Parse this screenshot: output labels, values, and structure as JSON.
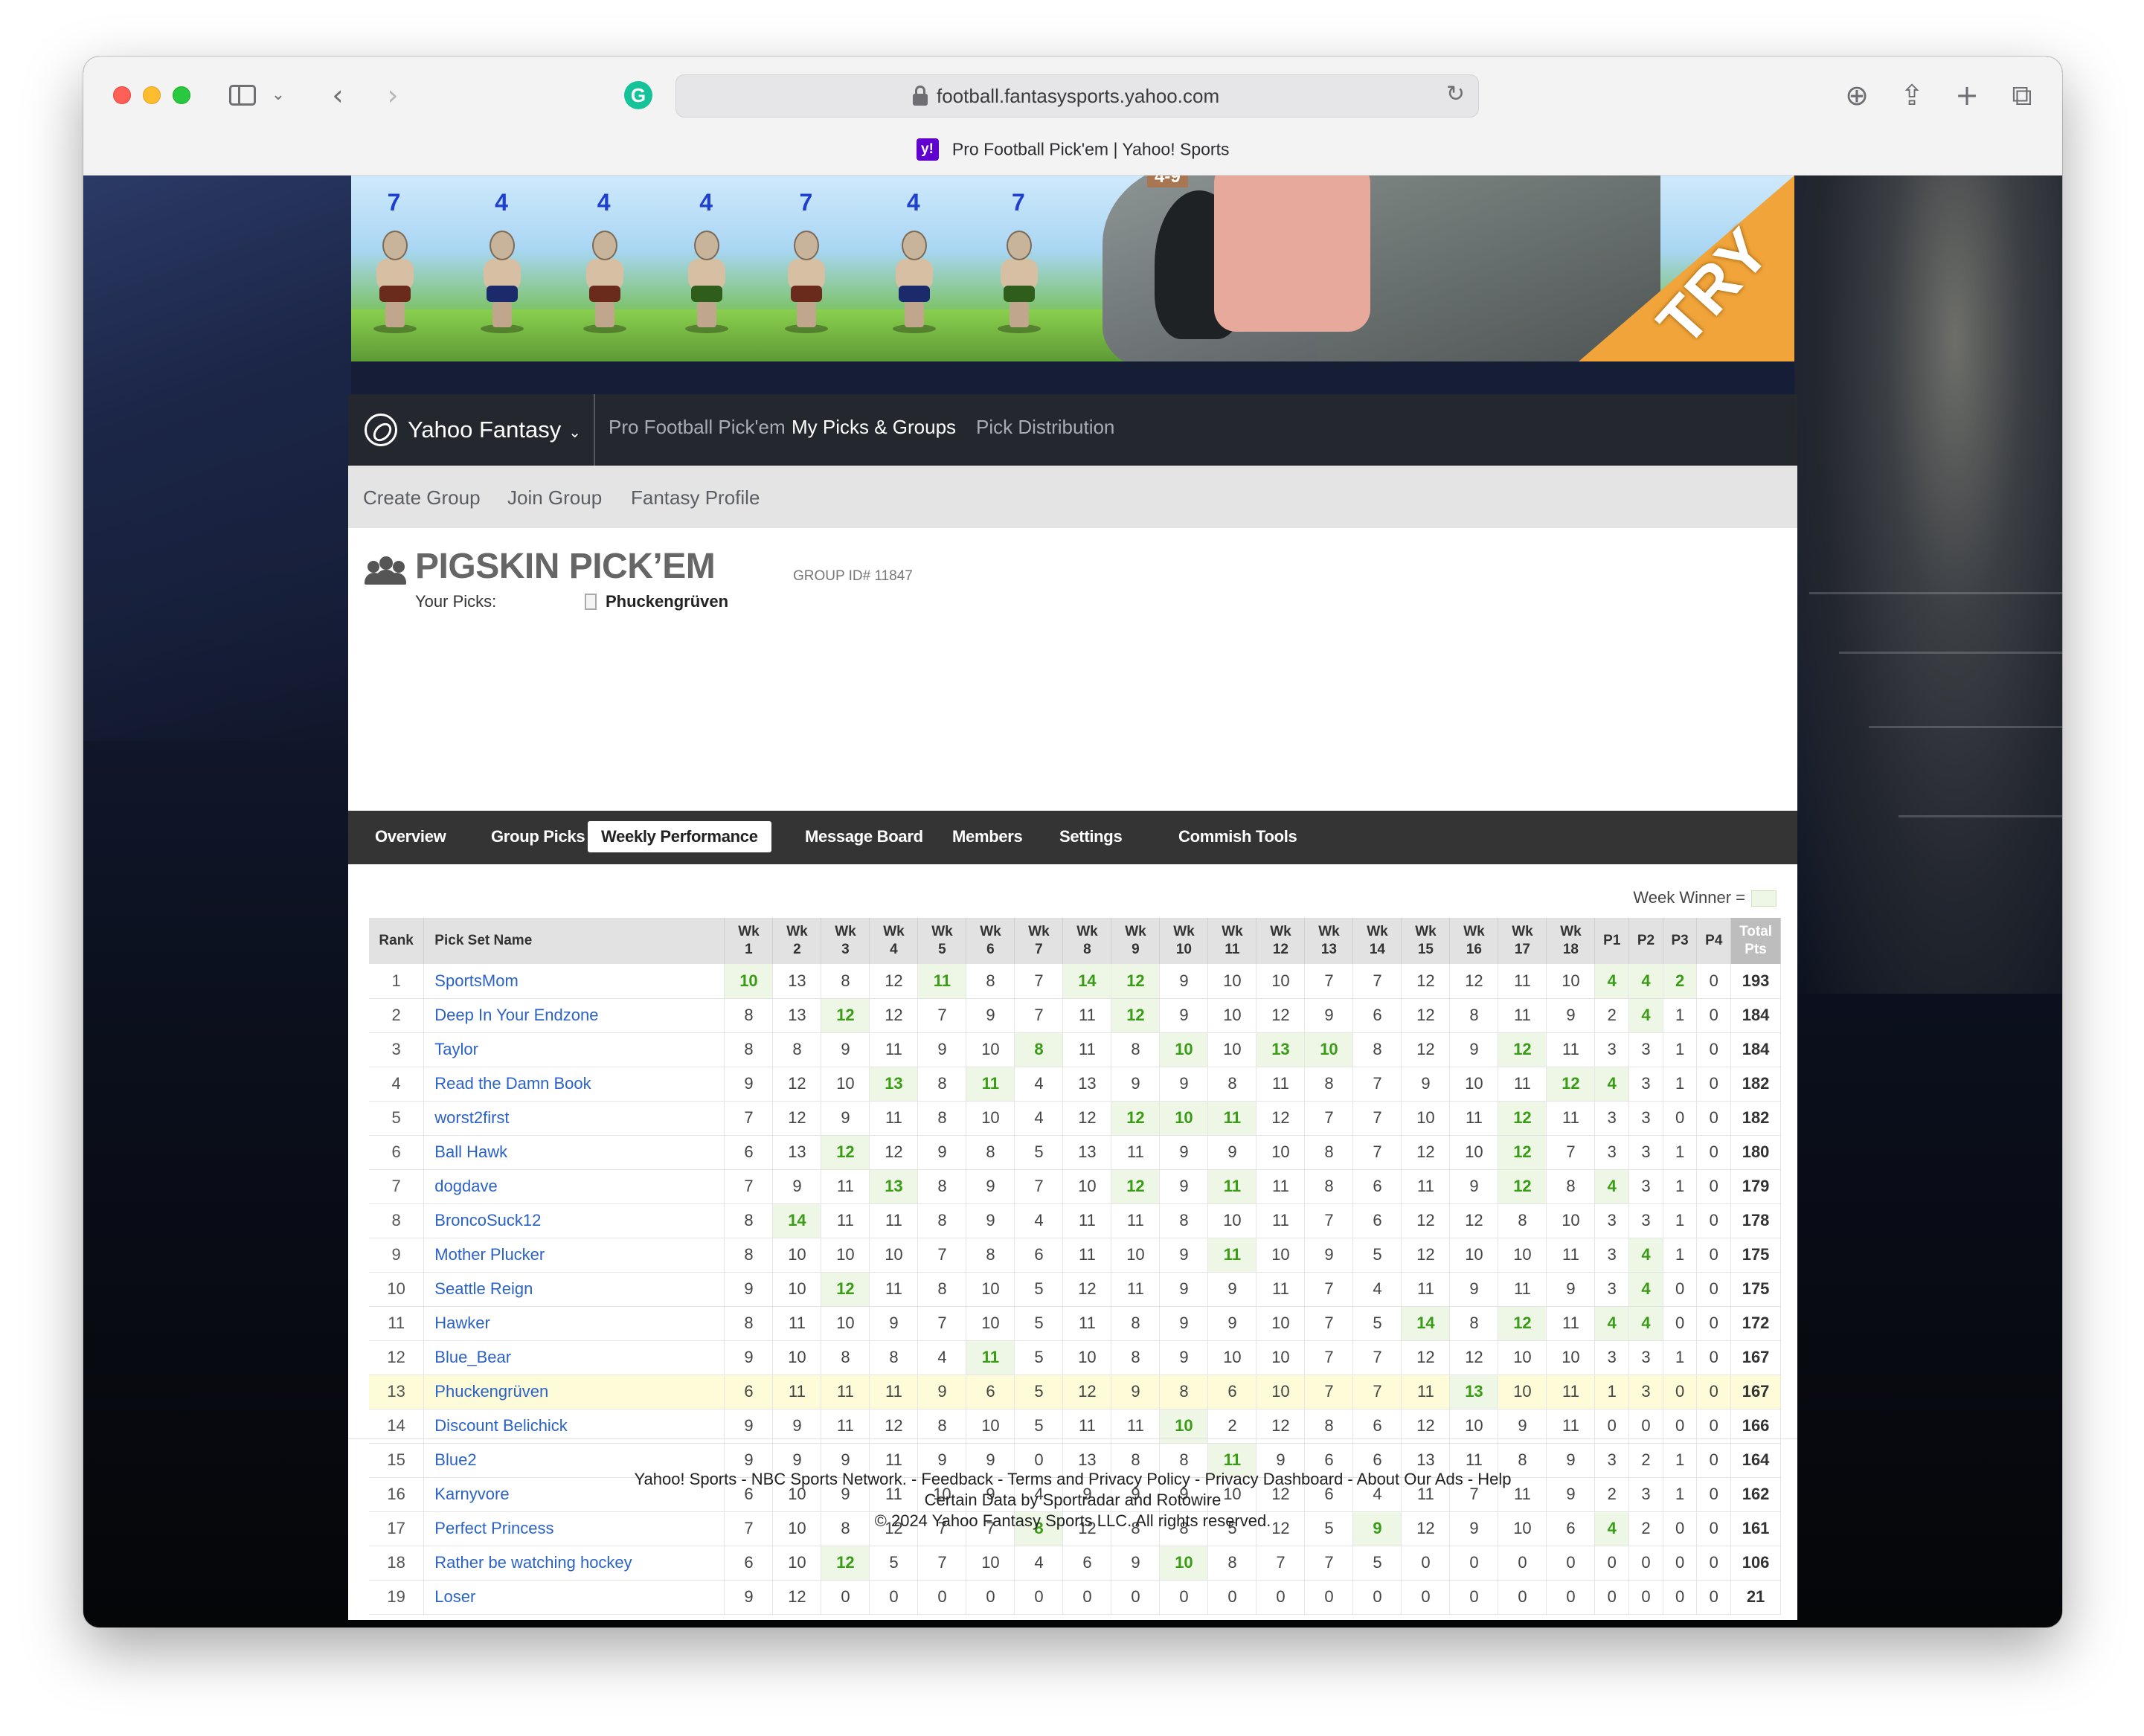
{
  "browser": {
    "address": "football.fantasysports.yahoo.com",
    "tab_title": "Pro Football Pick'em | Yahoo! Sports",
    "favicon_text": "y!"
  },
  "ad": {
    "numbers": [
      "7",
      "4",
      "4",
      "4",
      "7",
      "4",
      "7"
    ],
    "rock_label": "4-9",
    "cta": "TRY"
  },
  "nav": {
    "brand": "Yahoo Fantasy",
    "links": [
      "Pro Football Pick'em",
      "My Picks & Groups",
      "Pick Distribution"
    ],
    "active": "My Picks & Groups"
  },
  "subnav": [
    "Create Group",
    "Join Group",
    "Fantasy Profile"
  ],
  "group": {
    "title": "PIGSKIN PICK’EM",
    "id_label": "GROUP ID# 11847",
    "your_picks_label": "Your Picks:",
    "your_picks_name": "Phuckengrüven"
  },
  "tabs": [
    "Overview",
    "Group Picks",
    "Weekly Performance",
    "Message Board",
    "Members",
    "Settings",
    "Commish Tools"
  ],
  "active_tab": "Weekly Performance",
  "legend": "Week Winner =",
  "table": {
    "headers": {
      "rank": "Rank",
      "name": "Pick Set Name",
      "weeks": [
        "1",
        "2",
        "3",
        "4",
        "5",
        "6",
        "7",
        "8",
        "9",
        "10",
        "11",
        "12",
        "13",
        "14",
        "15",
        "16",
        "17",
        "18"
      ],
      "week_prefix": "Wk",
      "playoffs": [
        "P1",
        "P2",
        "P3",
        "P4"
      ],
      "total_top": "Total",
      "total_bottom": "Pts"
    },
    "rows": [
      {
        "rank": "1",
        "name": "SportsMom",
        "weeks": [
          "10",
          "13",
          "8",
          "12",
          "11",
          "8",
          "7",
          "14",
          "12",
          "9",
          "10",
          "10",
          "7",
          "7",
          "12",
          "12",
          "11",
          "10"
        ],
        "playoffs": [
          "4",
          "4",
          "2",
          "0"
        ],
        "total": "193",
        "wins": [
          0,
          4,
          7,
          8,
          18,
          19,
          20
        ]
      },
      {
        "rank": "2",
        "name": "Deep In Your Endzone",
        "weeks": [
          "8",
          "13",
          "12",
          "12",
          "7",
          "9",
          "7",
          "11",
          "12",
          "9",
          "10",
          "12",
          "9",
          "6",
          "12",
          "8",
          "11",
          "9"
        ],
        "playoffs": [
          "2",
          "4",
          "1",
          "0"
        ],
        "total": "184",
        "wins": [
          2,
          8,
          19
        ]
      },
      {
        "rank": "3",
        "name": "Taylor",
        "weeks": [
          "8",
          "8",
          "9",
          "11",
          "9",
          "10",
          "8",
          "11",
          "8",
          "10",
          "10",
          "13",
          "10",
          "8",
          "12",
          "9",
          "12",
          "11"
        ],
        "playoffs": [
          "3",
          "3",
          "1",
          "0"
        ],
        "total": "184",
        "wins": [
          6,
          9,
          11,
          12,
          16
        ]
      },
      {
        "rank": "4",
        "name": "Read the Damn Book",
        "weeks": [
          "9",
          "12",
          "10",
          "13",
          "8",
          "11",
          "4",
          "13",
          "9",
          "9",
          "8",
          "11",
          "8",
          "7",
          "9",
          "10",
          "11",
          "12"
        ],
        "playoffs": [
          "4",
          "3",
          "1",
          "0"
        ],
        "total": "182",
        "wins": [
          3,
          5,
          17,
          18
        ]
      },
      {
        "rank": "5",
        "name": "worst2first",
        "weeks": [
          "7",
          "12",
          "9",
          "11",
          "8",
          "10",
          "4",
          "12",
          "12",
          "10",
          "11",
          "12",
          "7",
          "7",
          "10",
          "11",
          "12",
          "11"
        ],
        "playoffs": [
          "3",
          "3",
          "0",
          "0"
        ],
        "total": "182",
        "wins": [
          8,
          9,
          10,
          16
        ]
      },
      {
        "rank": "6",
        "name": "Ball Hawk",
        "weeks": [
          "6",
          "13",
          "12",
          "12",
          "9",
          "8",
          "5",
          "13",
          "11",
          "9",
          "9",
          "10",
          "8",
          "7",
          "12",
          "10",
          "12",
          "7"
        ],
        "playoffs": [
          "3",
          "3",
          "1",
          "0"
        ],
        "total": "180",
        "wins": [
          2,
          16
        ]
      },
      {
        "rank": "7",
        "name": "dogdave",
        "weeks": [
          "7",
          "9",
          "11",
          "13",
          "8",
          "9",
          "7",
          "10",
          "12",
          "9",
          "11",
          "11",
          "8",
          "6",
          "11",
          "9",
          "12",
          "8"
        ],
        "playoffs": [
          "4",
          "3",
          "1",
          "0"
        ],
        "total": "179",
        "wins": [
          3,
          8,
          10,
          16,
          18
        ]
      },
      {
        "rank": "8",
        "name": "BroncoSuck12",
        "weeks": [
          "8",
          "14",
          "11",
          "11",
          "8",
          "9",
          "4",
          "11",
          "11",
          "8",
          "10",
          "11",
          "7",
          "6",
          "12",
          "12",
          "8",
          "10"
        ],
        "playoffs": [
          "3",
          "3",
          "1",
          "0"
        ],
        "total": "178",
        "wins": [
          1
        ]
      },
      {
        "rank": "9",
        "name": "Mother Plucker",
        "weeks": [
          "8",
          "10",
          "10",
          "10",
          "7",
          "8",
          "6",
          "11",
          "10",
          "9",
          "11",
          "10",
          "9",
          "5",
          "12",
          "10",
          "10",
          "11"
        ],
        "playoffs": [
          "3",
          "4",
          "1",
          "0"
        ],
        "total": "175",
        "wins": [
          10,
          19
        ]
      },
      {
        "rank": "10",
        "name": "Seattle Reign",
        "weeks": [
          "9",
          "10",
          "12",
          "11",
          "8",
          "10",
          "5",
          "12",
          "11",
          "9",
          "9",
          "11",
          "7",
          "4",
          "11",
          "9",
          "11",
          "9"
        ],
        "playoffs": [
          "3",
          "4",
          "0",
          "0"
        ],
        "total": "175",
        "wins": [
          2,
          19
        ]
      },
      {
        "rank": "11",
        "name": "Hawker",
        "weeks": [
          "8",
          "11",
          "10",
          "9",
          "7",
          "10",
          "5",
          "11",
          "8",
          "9",
          "9",
          "10",
          "7",
          "5",
          "14",
          "8",
          "12",
          "11"
        ],
        "playoffs": [
          "4",
          "4",
          "0",
          "0"
        ],
        "total": "172",
        "wins": [
          14,
          16,
          18,
          19
        ]
      },
      {
        "rank": "12",
        "name": "Blue_Bear",
        "weeks": [
          "9",
          "10",
          "8",
          "8",
          "4",
          "11",
          "5",
          "10",
          "8",
          "9",
          "10",
          "10",
          "7",
          "7",
          "12",
          "12",
          "10",
          "10"
        ],
        "playoffs": [
          "3",
          "3",
          "1",
          "0"
        ],
        "total": "167",
        "wins": [
          5
        ]
      },
      {
        "rank": "13",
        "name": "Phuckengrüven",
        "weeks": [
          "6",
          "11",
          "11",
          "11",
          "9",
          "6",
          "5",
          "12",
          "9",
          "8",
          "6",
          "10",
          "7",
          "7",
          "11",
          "13",
          "10",
          "11"
        ],
        "playoffs": [
          "1",
          "3",
          "0",
          "0"
        ],
        "total": "167",
        "wins": [
          15
        ],
        "me": true
      },
      {
        "rank": "14",
        "name": "Discount Belichick",
        "weeks": [
          "9",
          "9",
          "11",
          "12",
          "8",
          "10",
          "5",
          "11",
          "11",
          "10",
          "2",
          "12",
          "8",
          "6",
          "12",
          "10",
          "9",
          "11"
        ],
        "playoffs": [
          "0",
          "0",
          "0",
          "0"
        ],
        "total": "166",
        "wins": [
          9
        ]
      },
      {
        "rank": "15",
        "name": "Blue2",
        "weeks": [
          "9",
          "9",
          "9",
          "11",
          "9",
          "9",
          "0",
          "13",
          "8",
          "8",
          "11",
          "9",
          "6",
          "6",
          "13",
          "11",
          "8",
          "9"
        ],
        "playoffs": [
          "3",
          "2",
          "1",
          "0"
        ],
        "total": "164",
        "wins": [
          10
        ]
      },
      {
        "rank": "16",
        "name": "Karnyvore",
        "weeks": [
          "6",
          "10",
          "9",
          "11",
          "10",
          "9",
          "4",
          "9",
          "9",
          "9",
          "10",
          "12",
          "6",
          "4",
          "11",
          "7",
          "11",
          "9"
        ],
        "playoffs": [
          "2",
          "3",
          "1",
          "0"
        ],
        "total": "162",
        "wins": []
      },
      {
        "rank": "17",
        "name": "Perfect Princess",
        "weeks": [
          "7",
          "10",
          "8",
          "12",
          "7",
          "7",
          "8",
          "12",
          "8",
          "8",
          "5",
          "12",
          "5",
          "9",
          "12",
          "9",
          "10",
          "6"
        ],
        "playoffs": [
          "4",
          "2",
          "0",
          "0"
        ],
        "total": "161",
        "wins": [
          6,
          13,
          18
        ]
      },
      {
        "rank": "18",
        "name": "Rather be watching hockey",
        "weeks": [
          "6",
          "10",
          "12",
          "5",
          "7",
          "10",
          "4",
          "6",
          "9",
          "10",
          "8",
          "7",
          "7",
          "5",
          "0",
          "0",
          "0",
          "0"
        ],
        "playoffs": [
          "0",
          "0",
          "0",
          "0"
        ],
        "total": "106",
        "wins": [
          2,
          9
        ]
      },
      {
        "rank": "19",
        "name": "Loser",
        "weeks": [
          "9",
          "12",
          "0",
          "0",
          "0",
          "0",
          "0",
          "0",
          "0",
          "0",
          "0",
          "0",
          "0",
          "0",
          "0",
          "0",
          "0",
          "0"
        ],
        "playoffs": [
          "0",
          "0",
          "0",
          "0"
        ],
        "total": "21",
        "wins": []
      }
    ]
  },
  "footer": {
    "line1": "Yahoo! Sports - NBC Sports Network. - Feedback - Terms and Privacy Policy - Privacy Dashboard  - About Our Ads - Help",
    "line2": "Certain Data by Sportradar and Rotowire",
    "line3": "© 2024 Yahoo Fantasy Sports LLC. All rights reserved."
  },
  "colors": {
    "link": "#2b62c6",
    "win_bg": "#eef7e6",
    "win_text": "#3a9b17",
    "me_row": "#fdfbd8",
    "tab_bar": "#343434"
  }
}
